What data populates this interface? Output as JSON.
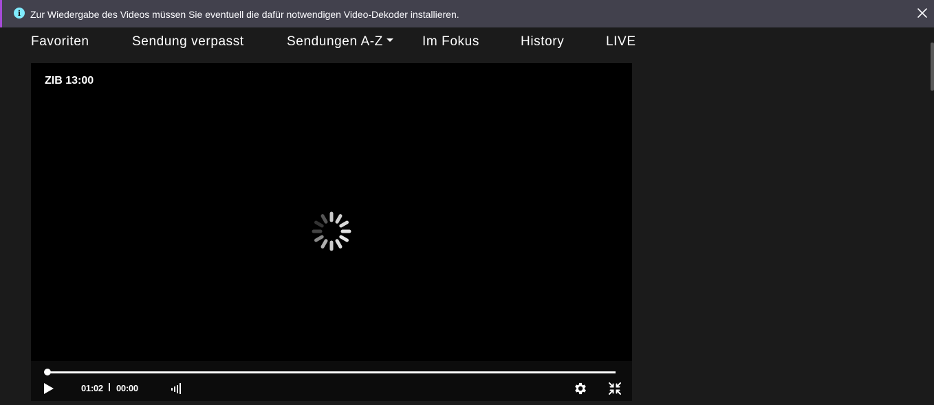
{
  "notification": {
    "message": "Zur Wiedergabe des Videos müssen Sie eventuell die dafür notwendigen Video-Dekoder installieren.",
    "icon": "info-icon",
    "close_icon": "close-icon"
  },
  "nav": {
    "items": [
      {
        "label": "Favoriten"
      },
      {
        "label": "Sendung verpasst"
      },
      {
        "label": "Sendungen A-Z"
      },
      {
        "label": "Im Fokus"
      },
      {
        "label": "History"
      },
      {
        "label": "LIVE"
      }
    ]
  },
  "player": {
    "title": "ZIB 13:00",
    "elapsed": "01:02",
    "remaining": "00:00",
    "progress_fraction": 0.0
  },
  "colors": {
    "notification_bg": "#42414d",
    "page_bg": "#1b1b1b",
    "player_bg": "#000000",
    "accent": "#a64bd8"
  }
}
